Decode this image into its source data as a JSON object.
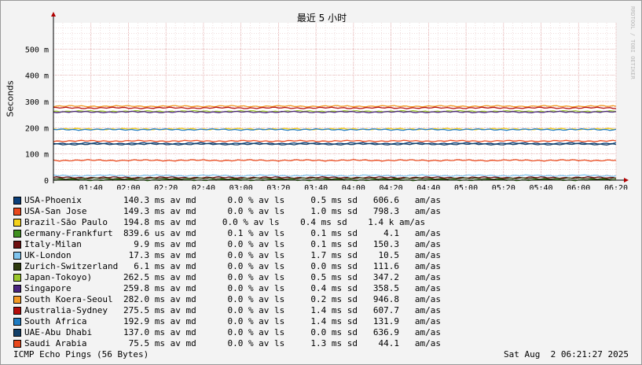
{
  "chart_data": {
    "type": "line",
    "title": "最近 5 小时",
    "ylabel": "Seconds",
    "watermark": "RRDTOOL / TOBI OETIKER",
    "ylim": [
      0,
      0.6
    ],
    "y_ticks": [
      {
        "value": 0,
        "label": "0"
      },
      {
        "value": 0.1,
        "label": "100 m"
      },
      {
        "value": 0.2,
        "label": "200 m"
      },
      {
        "value": 0.3,
        "label": "300 m"
      },
      {
        "value": 0.4,
        "label": "400 m"
      },
      {
        "value": 0.5,
        "label": "500 m"
      }
    ],
    "x_range": [
      "01:20",
      "06:20"
    ],
    "x_ticks": [
      "01:40",
      "02:00",
      "02:20",
      "02:40",
      "03:00",
      "03:20",
      "03:40",
      "04:00",
      "04:20",
      "04:40",
      "05:00",
      "05:20",
      "05:40",
      "06:00",
      "06:20"
    ],
    "grid": true,
    "series": [
      {
        "name": "USA-Phoenix",
        "color": "#0b3f7a",
        "values": [
          0.1403
        ]
      },
      {
        "name": "USA-San Jose",
        "color": "#e8481c",
        "values": [
          0.1493
        ]
      },
      {
        "name": "Brazil-São Paulo",
        "color": "#f5d21b",
        "values": [
          0.1948
        ]
      },
      {
        "name": "Germany-Frankfurt",
        "color": "#3f8f1f",
        "values": [
          0.0008396
        ]
      },
      {
        "name": "Italy-Milan",
        "color": "#6e1111",
        "values": [
          0.0099
        ]
      },
      {
        "name": "UK-London",
        "color": "#7fc4ee",
        "values": [
          0.0173
        ]
      },
      {
        "name": "Zurich-Switzerland",
        "color": "#2e3a0e",
        "values": [
          0.0061
        ]
      },
      {
        "name": "Japan-Tokoyo)",
        "color": "#9bc72c",
        "values": [
          0.2625
        ]
      },
      {
        "name": "Singapore",
        "color": "#4b2580",
        "values": [
          0.2598
        ]
      },
      {
        "name": "South Koera-Seoul",
        "color": "#f49a25",
        "values": [
          0.282
        ]
      },
      {
        "name": "Australia-Sydney",
        "color": "#b30d0d",
        "values": [
          0.2755
        ]
      },
      {
        "name": "South Africa",
        "color": "#1f7cc2",
        "values": [
          0.1929
        ]
      },
      {
        "name": "UAE-Abu Dhabi",
        "color": "#123f68",
        "values": [
          0.137
        ]
      },
      {
        "name": "Saudi Arabia",
        "color": "#e8481c",
        "values": [
          0.0755
        ]
      }
    ]
  },
  "legend": [
    {
      "name": "USA-Phoenix",
      "color": "#0b3f7a",
      "stats": "140.3 ms av md      0.0 % av ls     0.5 ms sd   606.6   am/as"
    },
    {
      "name": "USA-San Jose",
      "color": "#e8481c",
      "stats": "149.3 ms av md      0.0 % av ls     1.0 ms sd   798.3   am/as"
    },
    {
      "name": "Brazil-São Paulo",
      "color": "#f5d21b",
      "stats": "194.8 ms av md     0.0 % av ls    0.4 ms sd    1.4 k am/as"
    },
    {
      "name": "Germany-Frankfurt",
      "color": "#3f8f1f",
      "stats": "839.6 us av md      0.1 % av ls     0.1 ms sd     4.1   am/as"
    },
    {
      "name": "Italy-Milan",
      "color": "#6e1111",
      "stats": "  9.9 ms av md      0.0 % av ls     0.1 ms sd   150.3   am/as"
    },
    {
      "name": "UK-London",
      "color": "#7fc4ee",
      "stats": " 17.3 ms av md      0.0 % av ls     1.7 ms sd    10.5   am/as"
    },
    {
      "name": "Zurich-Switzerland",
      "color": "#2e3a0e",
      "stats": "  6.1 ms av md      0.0 % av ls     0.0 ms sd   111.6   am/as"
    },
    {
      "name": "Japan-Tokoyo)",
      "color": "#9bc72c",
      "stats": "262.5 ms av md      0.0 % av ls     0.5 ms sd   347.2   am/as"
    },
    {
      "name": "Singapore",
      "color": "#4b2580",
      "stats": "259.8 ms av md      0.0 % av ls     0.4 ms sd   358.5   am/as"
    },
    {
      "name": "South Koera-Seoul",
      "color": "#f49a25",
      "stats": "282.0 ms av md      0.0 % av ls     0.2 ms sd   946.8   am/as"
    },
    {
      "name": "Australia-Sydney",
      "color": "#b30d0d",
      "stats": "275.5 ms av md      0.0 % av ls     1.4 ms sd   607.7   am/as"
    },
    {
      "name": "South Africa",
      "color": "#1f7cc2",
      "stats": "192.9 ms av md      0.0 % av ls     1.4 ms sd   131.9   am/as"
    },
    {
      "name": "UAE-Abu Dhabi",
      "color": "#123f68",
      "stats": "137.0 ms av md      0.0 % av ls     0.0 ms sd   636.9   am/as"
    },
    {
      "name": "Saudi Arabia",
      "color": "#e8481c",
      "stats": " 75.5 ms av md      0.0 % av ls     1.3 ms sd    44.1   am/as"
    }
  ],
  "footer": {
    "left": "ICMP Echo Pings (56 Bytes)",
    "right": "Sat Aug  2 06:21:27 2025"
  }
}
